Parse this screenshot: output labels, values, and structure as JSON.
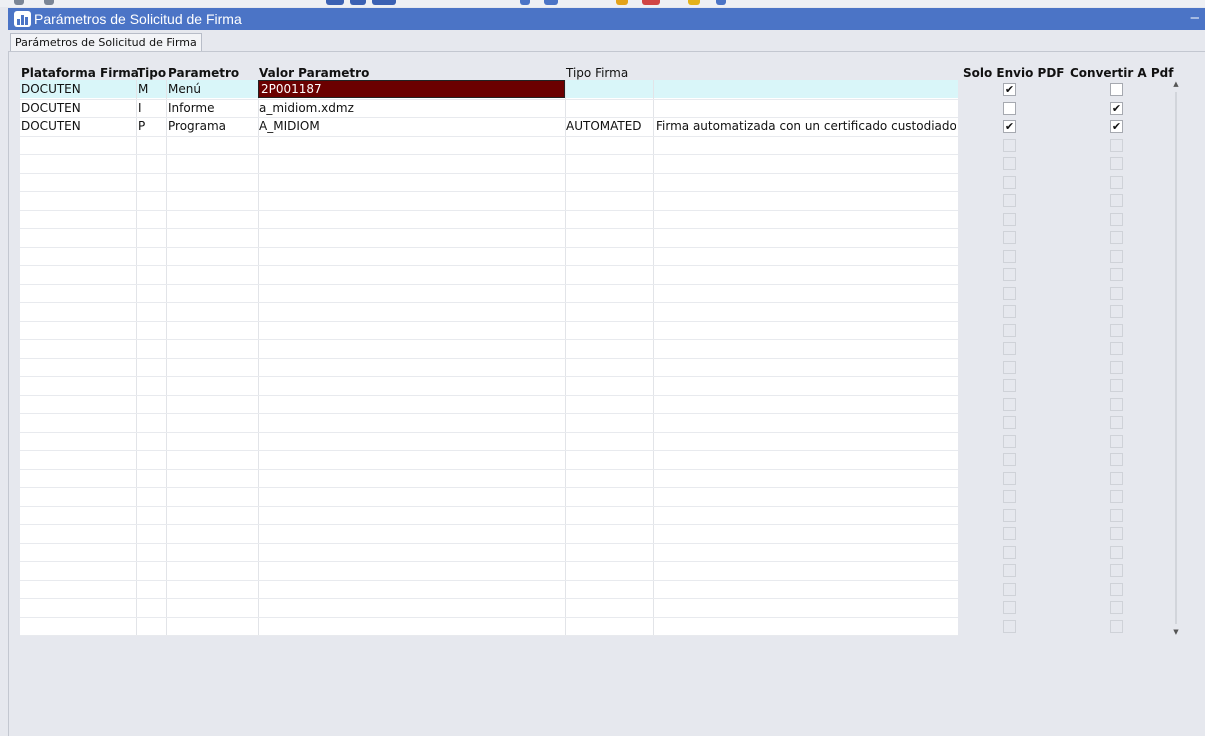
{
  "window": {
    "title": "Parámetros de Solicitud de Firma",
    "minimize_glyph": "–"
  },
  "tab": {
    "label": "Parámetros de Solicitud de Firma"
  },
  "columns": {
    "plataforma": "Plataforma Firma",
    "tipo": "Tipo",
    "parametro": "Parametro",
    "valor": "Valor Parametro",
    "tipo_firma": "Tipo Firma",
    "solo_envio": "Solo Envio PDF",
    "convertir": "Convertir A Pdf"
  },
  "rows": [
    {
      "plataforma": "DOCUTEN",
      "tipo": "M",
      "parametro": "Menú",
      "valor": "2P001187",
      "tipo_firma": "",
      "descripcion": "",
      "solo_envio_pdf": true,
      "convertir_pdf": false
    },
    {
      "plataforma": "DOCUTEN",
      "tipo": "I",
      "parametro": "Informe",
      "valor": "a_midiom.xdmz",
      "tipo_firma": "",
      "descripcion": "",
      "solo_envio_pdf": false,
      "convertir_pdf": true
    },
    {
      "plataforma": "DOCUTEN",
      "tipo": "P",
      "parametro": "Programa",
      "valor": "A_MIDIOM",
      "tipo_firma": "AUTOMATED",
      "descripcion": "Firma automatizada con un certificado custodiado en",
      "solo_envio_pdf": true,
      "convertir_pdf": true
    }
  ],
  "empty_row_count": 27,
  "check_glyph": "✔",
  "colors": {
    "titlebar": "#4b74c6",
    "selected_cell": "#6b0000",
    "row_highlight": "#d9f6f9"
  }
}
